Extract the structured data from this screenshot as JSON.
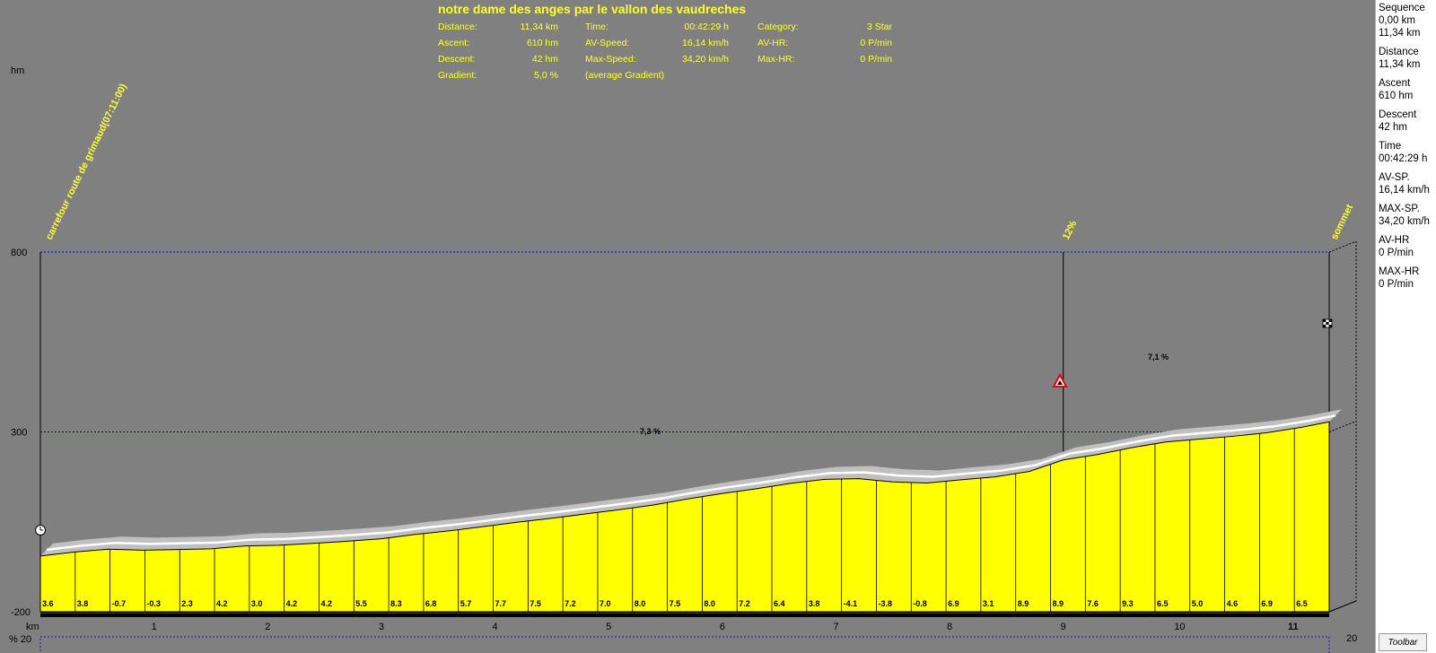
{
  "header": {
    "title": "notre dame des anges par le vallon des vaudreches",
    "stats": [
      [
        "Distance:",
        "11,34 km",
        "Time:",
        "00:42:29 h",
        "Category:",
        "3 Star"
      ],
      [
        "Ascent:",
        "610 hm",
        "AV-Speed:",
        "16,14 km/h",
        "AV-HR:",
        "0 P/min"
      ],
      [
        "Descent:",
        "42 hm",
        "Max-Speed:",
        "34,20 km/h",
        "Max-HR:",
        "0 P/min"
      ],
      [
        "Gradient:",
        "5,0 %",
        "(average Gradient)",
        "",
        "",
        ""
      ]
    ]
  },
  "axes": {
    "y_unit": "hm",
    "x_unit": "km",
    "grad_unit": "% 20",
    "grad_right": "20"
  },
  "annotations": {
    "start": "carrefour route de grimaud(07:11:00)",
    "climb": "12%",
    "summit": "sommet",
    "grad_1": "7,3 %",
    "grad_2": "7,1 %"
  },
  "chart_data": {
    "type": "area",
    "xlabel": "km",
    "ylabel": "hm",
    "xlim": [
      0,
      11.34
    ],
    "ylim": [
      -200,
      800
    ],
    "y_ticks": [
      -200,
      300,
      800
    ],
    "x_ticks": [
      1,
      2,
      3,
      4,
      5,
      6,
      7,
      8,
      9,
      10,
      11
    ],
    "gridlines_y": [
      300,
      800
    ],
    "profile_x": [
      0,
      0.3,
      0.6,
      0.9,
      1.2,
      1.5,
      1.8,
      2.1,
      2.4,
      2.7,
      3.0,
      3.3,
      3.6,
      3.9,
      4.2,
      4.5,
      4.8,
      5.1,
      5.4,
      5.7,
      6.0,
      6.3,
      6.6,
      6.9,
      7.2,
      7.5,
      7.8,
      8.1,
      8.4,
      8.7,
      9.0,
      9.3,
      9.6,
      9.9,
      10.2,
      10.5,
      10.8,
      11.1,
      11.34
    ],
    "profile_y": [
      -45,
      -34,
      -26,
      -29,
      -27,
      -25,
      -17,
      -15,
      -10,
      -4,
      3,
      15,
      25,
      37,
      49,
      60,
      72,
      84,
      97,
      114,
      129,
      142,
      157,
      168,
      170,
      161,
      158,
      167,
      175,
      190,
      222,
      237,
      256,
      272,
      280,
      288,
      298,
      313,
      328
    ],
    "segment_gradients": [
      "3.6",
      "3.8",
      "-0.7",
      "-0.3",
      "2.3",
      "4.2",
      "3.0",
      "4.2",
      "4.2",
      "5.5",
      "8.3",
      "6.8",
      "5.7",
      "7.7",
      "7.5",
      "7.2",
      "7.0",
      "8.0",
      "7.5",
      "8.0",
      "7.2",
      "6.4",
      "3.8",
      "-4.1",
      "-3.8",
      "-0.8",
      "6.9",
      "3.1",
      "8.9",
      "8.9",
      "7.6",
      "9.3",
      "6.5",
      "5.0",
      "4.6",
      "6.9",
      "6.5"
    ],
    "markers": [
      {
        "label": "carrefour route de grimaud(07:11:00)",
        "x": 0,
        "y": -45
      },
      {
        "label": "12%",
        "x": 9.0,
        "y": 222
      },
      {
        "label": "sommet",
        "x": 11.34,
        "y": 328
      }
    ],
    "colors": {
      "fill": "#ffff00",
      "background": "#808080",
      "label": "#ffff33",
      "grid": "#0000cc"
    }
  },
  "sidebar": {
    "items": [
      {
        "label": "Sequence",
        "value": "0,00 km",
        "value2": "11,34 km"
      },
      {
        "label": "Distance",
        "value": "11,34 km"
      },
      {
        "label": "Ascent",
        "value": "610 hm"
      },
      {
        "label": "Descent",
        "value": "42 hm"
      },
      {
        "label": "Time",
        "value": "00:42:29 h"
      },
      {
        "label": "AV-SP.",
        "value": "16,14 km/h"
      },
      {
        "label": "MAX-SP.",
        "value": "34,20 km/h"
      },
      {
        "label": "AV-HR",
        "value": "0 P/min"
      },
      {
        "label": "MAX-HR",
        "value": "0 P/min"
      }
    ],
    "toolbar_label": "Toolbar"
  }
}
